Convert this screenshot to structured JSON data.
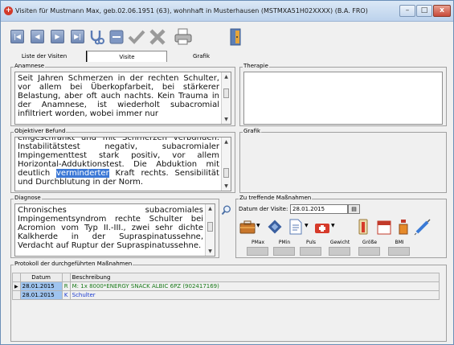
{
  "window": {
    "title": "Visiten für Mustmann Max, geb.02.06.1951 (63), wohnhaft in Musterhausen (MSTMXA51H02XXXX) (B.A. FRO)",
    "minimize_glyph": "–",
    "maximize_glyph": "□",
    "close_glyph": "x"
  },
  "toolbar": {
    "nav_first": "|◀",
    "nav_prev": "◀",
    "nav_next": "▶",
    "nav_last": "▶|",
    "icons": [
      "record-nav-first-icon",
      "record-nav-prev-icon",
      "record-nav-next-icon",
      "record-nav-last-icon",
      "stethoscope-icon",
      "minus-icon",
      "check-icon",
      "delete-x-icon",
      "printer-icon",
      "exit-door-icon"
    ]
  },
  "tabs": [
    {
      "label": "Liste der Visiten"
    },
    {
      "label": "Visite"
    },
    {
      "label": "Grafik"
    }
  ],
  "anamnese": {
    "label": "Anamnese",
    "text": "Seit Jahren Schmerzen in der rechten Schulter, vor allem bei Überkopfarbeit, bei stärkerer Belastung, aber oft auch nachts. Kein Trauma in der Anamnese, ist wiederholt subacromial infiltriert worden, wobei immer nur"
  },
  "therapie": {
    "label": "Therapie",
    "text": ""
  },
  "befund": {
    "label": "Objektiver Befund",
    "before": "eingeschränkt und mit Schmerzen verbunden. Instabilitätstest negativ, subacromialer Impingementtest stark positiv, vor allem Horizontal-Adduktionstest. Die Abduktion mit deutlich ",
    "highlight": "verminderter",
    "after": " Kraft rechts. Sensibilität und Durchblutung in der Norm."
  },
  "grafik": {
    "label": "Grafik"
  },
  "diagnose": {
    "label": "Diagnose",
    "text": "Chronisches subacromiales Impingementsyndrom rechte Schulter bei Acromion vom Typ II.-III., zwei sehr dichte Kalkherde in der Supraspinatussehne, Verdacht auf Ruptur der Supraspinatussehne."
  },
  "massnahmen": {
    "label": "Zu treffende Maßnahmen",
    "date_label": "Datum der Visite:",
    "date_value": "28.01.2015",
    "measure_labels": [
      "PMax",
      "PMin",
      "Puls",
      "Gewicht",
      "Größe",
      "BMI"
    ]
  },
  "protokoll": {
    "label": "Protokoll der durchgeführten Maßnahmen",
    "columns": [
      "Datum",
      "Beschreibung"
    ],
    "rows": [
      {
        "date": "28.01.2015",
        "code": "R",
        "desc": "M: 1x 8000*ENERGY SNACK ALBIC 6PZ (902417169)",
        "color": "#1a7a1a"
      },
      {
        "date": "28.01.2015",
        "code": "K",
        "desc": "Schulter",
        "color": "#1a3ad0"
      }
    ]
  },
  "colors": {
    "titlebar": "#c9dbf0",
    "selection": "#3b78d6",
    "row_date_bg": "#9fc4ef"
  }
}
